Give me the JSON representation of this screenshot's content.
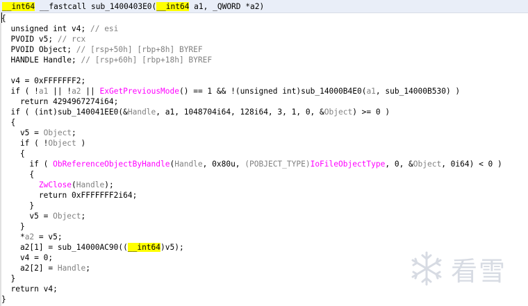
{
  "header": {
    "parts": [
      "__int64",
      " __fastcall sub_1400403E0(",
      "__int64",
      " a1, _QWORD *a2)"
    ]
  },
  "code": {
    "l01": "{",
    "l02a": "  unsigned int v4; ",
    "l02c": "// esi",
    "l03a": "  PVOID v5; ",
    "l03c": "// rcx",
    "l04a": "  PVOID Object; ",
    "l04c": "// [rsp+50h] [rbp+8h] BYREF",
    "l05a": "  HANDLE Handle; ",
    "l05c": "// [rsp+60h] [rbp+18h] BYREF",
    "l07": "  v4 = 0xFFFFFFF2;",
    "l08a": "  if ( !",
    "l08b": "a1",
    "l08c": " || !",
    "l08d": "a2",
    "l08e": " || ",
    "l08f": "ExGetPreviousMode",
    "l08g": "() == 1 && !(unsigned int)sub_14000B4E0(",
    "l08h": "a1",
    "l08i": ", sub_14000B530) )",
    "l09": "    return 4294967274i64;",
    "l10a": "  if ( (int)sub_140041EE0(&",
    "l10b": "Handle",
    "l10c": ", a1, 1048704i64, 128i64, 3, 1, 0, &",
    "l10d": "Object",
    "l10e": ") >= 0 )",
    "l11": "  {",
    "l12a": "    v5 = ",
    "l12b": "Object",
    "l12c": ";",
    "l13a": "    if ( !",
    "l13b": "Object",
    "l13c": " )",
    "l14": "    {",
    "l15a": "      if ( ",
    "l15b": "ObReferenceObjectByHandle",
    "l15c": "(",
    "l15d": "Handle",
    "l15e": ", 0x80u, ",
    "l15f": "(POBJECT_TYPE)",
    "l15g": "IoFileObjectType",
    "l15h": ", 0, &",
    "l15i": "Object",
    "l15j": ", 0i64) < 0 )",
    "l16": "      {",
    "l17a": "        ",
    "l17b": "ZwClose",
    "l17c": "(",
    "l17d": "Handle",
    "l17e": ");",
    "l18": "        return 0xFFFFFFF2i64;",
    "l19": "      }",
    "l20a": "      v5 = ",
    "l20b": "Object",
    "l20c": ";",
    "l21": "    }",
    "l22a": "    *",
    "l22b": "a2",
    "l22c": " = v5;",
    "l23a": "    a2[1] = sub_14000AC90((",
    "l23b": "__int64",
    "l23c": ")v5);",
    "l24": "    v4 = 0;",
    "l25a": "    a2[2] = ",
    "l25b": "Handle",
    "l25c": ";",
    "l26": "  }",
    "l27": "  return v4;",
    "l28": "}"
  },
  "watermark": {
    "text": "看雪"
  },
  "colors": {
    "header_bg": "#e9eef8",
    "highlight": "#ffff00",
    "comment": "#808080",
    "import": "#ff00ff",
    "keyword": "#000080"
  }
}
